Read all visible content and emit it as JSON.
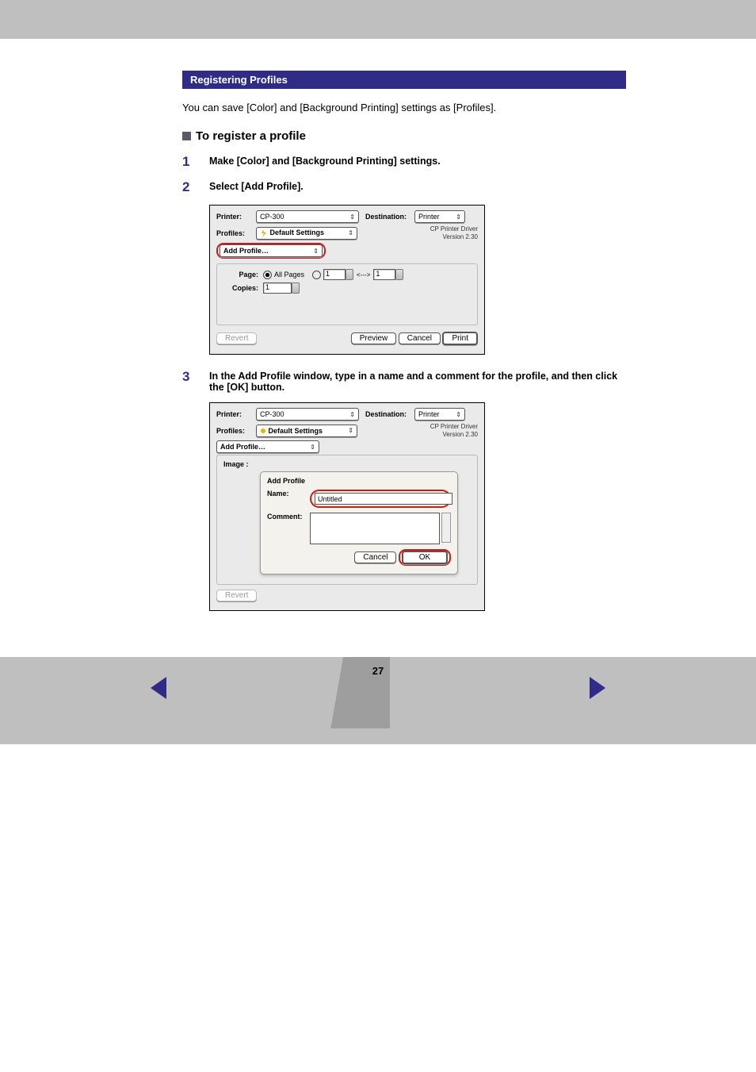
{
  "section": {
    "header": "Registering Profiles",
    "intro": "You can save [Color] and [Background Printing] settings as [Profiles].",
    "subhead": "To register a profile"
  },
  "steps": [
    {
      "num": "1",
      "text": "Make [Color] and [Background Printing] settings."
    },
    {
      "num": "2",
      "text": "Select [Add Profile]."
    },
    {
      "num": "3",
      "text": "In the Add Profile window, type in a name and a comment for the profile, and then click the [OK] button."
    }
  ],
  "dialog1": {
    "labels": {
      "printer": "Printer:",
      "profiles": "Profiles:",
      "destination": "Destination:",
      "page": "Page:",
      "copies": "Copies:",
      "all_pages": "All Pages"
    },
    "values": {
      "printer": "CP-300",
      "profiles": "Default Settings",
      "destination": "Printer",
      "panel_select": "Add Profile…",
      "from": "1",
      "to": "1",
      "copies": "1",
      "arrow_sep": "<--->"
    },
    "info": {
      "driver": "CP Printer Driver",
      "version": "Version 2.30"
    },
    "buttons": {
      "revert": "Revert",
      "preview": "Preview",
      "cancel": "Cancel",
      "print": "Print"
    }
  },
  "dialog2": {
    "labels": {
      "printer": "Printer:",
      "profiles": "Profiles:",
      "destination": "Destination:",
      "image": "Image :"
    },
    "values": {
      "printer": "CP-300",
      "profiles": "Default Settings",
      "destination": "Printer",
      "panel_select": "Add Profile…"
    },
    "info": {
      "driver": "CP Printer Driver",
      "version": "Version 2.30"
    },
    "panel": {
      "title": "Add Profile",
      "name_label": "Name:",
      "name_value": "Untitled",
      "comment_label": "Comment:",
      "comment_value": ""
    },
    "buttons": {
      "revert": "Revert",
      "cancel": "Cancel",
      "ok": "OK"
    }
  },
  "footer": {
    "page": "27"
  }
}
